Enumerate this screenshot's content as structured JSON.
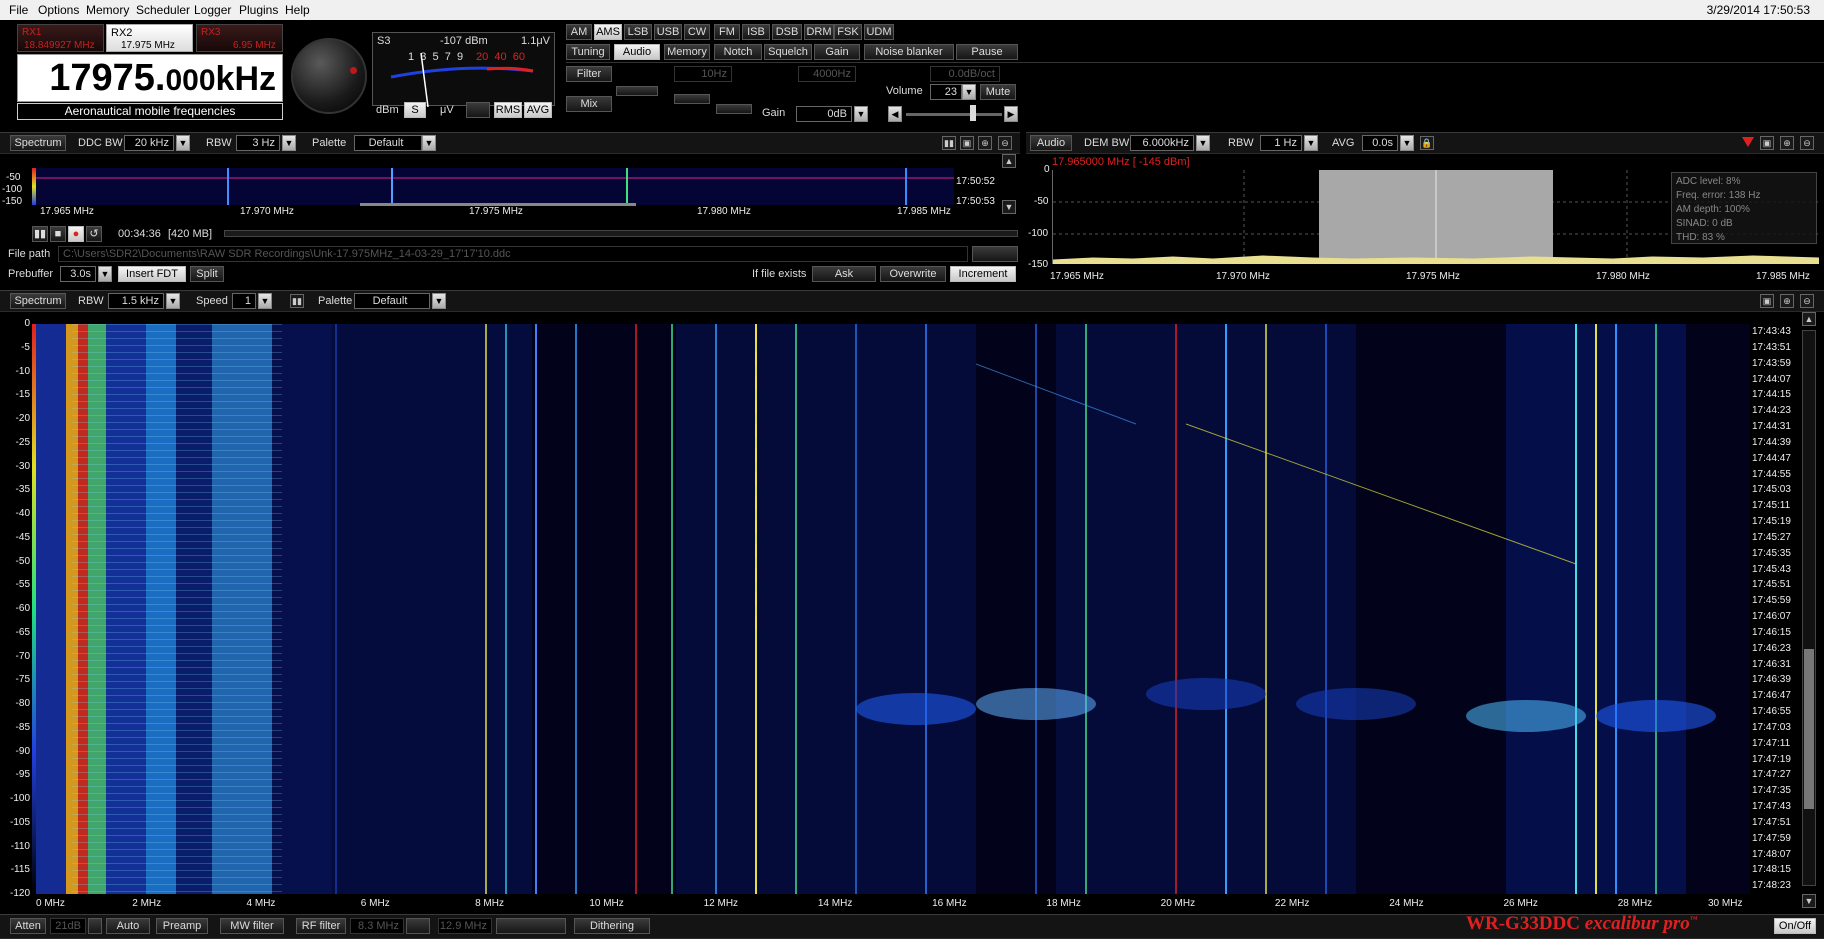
{
  "menu": {
    "items": [
      "File",
      "Options",
      "Memory",
      "Scheduler",
      "Logger",
      "Plugins",
      "Help"
    ],
    "datetime": "3/29/2014 17:50:53"
  },
  "receivers": [
    {
      "label": "RX1",
      "freq": "18.849927 MHz",
      "active": false
    },
    {
      "label": "RX2",
      "freq": "17.975 MHz",
      "active": true
    },
    {
      "label": "RX3",
      "freq": "6.95 MHz",
      "active": false
    }
  ],
  "frequency": {
    "main": "17975.",
    "fine": "000",
    "unit": "kHz",
    "description": "Aeronautical mobile frequencies"
  },
  "smeter": {
    "s_label": "S3",
    "dbm": "-107 dBm",
    "uv": "1.1μV",
    "scale_white": [
      "1",
      "3",
      "5",
      "7",
      "9"
    ],
    "scale_red": [
      "20",
      "40",
      "60"
    ],
    "units": [
      "dBm",
      "S",
      "μV"
    ],
    "selected_unit": "S",
    "modes": [
      "RMS",
      "AVG"
    ]
  },
  "modes": {
    "items": [
      "AM",
      "AMS",
      "LSB",
      "USB",
      "CW",
      "FM",
      "ISB",
      "DSB",
      "DRM",
      "FSK",
      "UDM"
    ],
    "selected": "AMS"
  },
  "tabs": {
    "items": [
      "Tuning",
      "Audio",
      "Memory",
      "Notch",
      "Squelch",
      "Gain",
      "Noise blanker",
      "Pause"
    ],
    "selected": "Audio"
  },
  "audio": {
    "filter_label": "Filter",
    "mix_label": "Mix",
    "filter_low": "10Hz",
    "filter_high": "4000Hz",
    "filter_slope": "0.0dB/oct",
    "volume_label": "Volume",
    "volume": "23",
    "mute_label": "Mute",
    "gain_label": "Gain",
    "gain": "0dB"
  },
  "ddc_spectrum": {
    "tab": "Spectrum",
    "ddc_bw_label": "DDC BW",
    "ddc_bw": "20 kHz",
    "rbw_label": "RBW",
    "rbw": "3 Hz",
    "palette_label": "Palette",
    "palette": "Default",
    "y_ticks": [
      "-50",
      "-100",
      "-150"
    ],
    "times": [
      "17:50:52",
      "17:50:53"
    ],
    "x_ticks": [
      "17.965 MHz",
      "17.970 MHz",
      "17.975 MHz",
      "17.980 MHz",
      "17.985 MHz"
    ]
  },
  "recording": {
    "elapsed": "00:34:36",
    "size": "[420 MB]",
    "file_path_label": "File path",
    "file_path": "C:\\Users\\SDR2\\Documents\\RAW SDR Recordings\\Unk-17.975MHz_14-03-29_17'17'10.ddc",
    "prebuffer_label": "Prebuffer",
    "prebuffer": "3.0s",
    "insert_fdt": "Insert FDT",
    "split": "Split",
    "if_exists_label": "If file exists",
    "options": [
      "Ask",
      "Overwrite",
      "Increment"
    ],
    "selected_option": "Increment"
  },
  "audio_spectrum": {
    "tab": "Audio",
    "dem_bw_label": "DEM BW",
    "dem_bw": "6.000kHz",
    "rbw_label": "RBW",
    "rbw": "1 Hz",
    "avg_label": "AVG",
    "avg": "0.0s",
    "marker": "17.965000 MHz [ -145 dBm]",
    "y_ticks": [
      "0",
      "-50",
      "-100",
      "-150"
    ],
    "x_ticks": [
      "17.965 MHz",
      "17.970 MHz",
      "17.975 MHz",
      "17.980 MHz",
      "17.985 MHz"
    ],
    "info": [
      "ADC level: 8%",
      "Freq. error: 138 Hz",
      "AM depth: 100%",
      "SINAD: 0 dB",
      "THD: 83 %"
    ]
  },
  "wideband": {
    "tab": "Spectrum",
    "rbw_label": "RBW",
    "rbw": "1.5 kHz",
    "speed_label": "Speed",
    "speed": "1",
    "palette_label": "Palette",
    "palette": "Default",
    "y_ticks": [
      "0",
      "-5",
      "-10",
      "-15",
      "-20",
      "-25",
      "-30",
      "-35",
      "-40",
      "-45",
      "-50",
      "-55",
      "-60",
      "-65",
      "-70",
      "-75",
      "-80",
      "-85",
      "-90",
      "-95",
      "-100",
      "-105",
      "-110",
      "-115",
      "-120"
    ],
    "x_ticks": [
      "0 MHz",
      "2 MHz",
      "4 MHz",
      "6 MHz",
      "8 MHz",
      "10 MHz",
      "12 MHz",
      "14 MHz",
      "16 MHz",
      "18 MHz",
      "20 MHz",
      "22 MHz",
      "24 MHz",
      "26 MHz",
      "28 MHz",
      "30 MHz"
    ],
    "times": [
      "17:43:43",
      "17:43:51",
      "17:43:59",
      "17:44:07",
      "17:44:15",
      "17:44:23",
      "17:44:31",
      "17:44:39",
      "17:44:47",
      "17:44:55",
      "17:45:03",
      "17:45:11",
      "17:45:19",
      "17:45:27",
      "17:45:35",
      "17:45:43",
      "17:45:51",
      "17:45:59",
      "17:46:07",
      "17:46:15",
      "17:46:23",
      "17:46:31",
      "17:46:39",
      "17:46:47",
      "17:46:55",
      "17:47:03",
      "17:47:11",
      "17:47:19",
      "17:47:27",
      "17:47:35",
      "17:47:43",
      "17:47:51",
      "17:47:59",
      "17:48:07",
      "17:48:15",
      "17:48:23"
    ]
  },
  "bottombar": {
    "atten_label": "Atten",
    "atten": "21dB",
    "auto": "Auto",
    "preamp": "Preamp",
    "mw_filter": "MW filter",
    "rf_filter_label": "RF filter",
    "rf_low": "8.3 MHz",
    "rf_high": "12.9 MHz",
    "dithering": "Dithering",
    "brand": "WR-G33DDC",
    "brand_sub": "excalibur pro",
    "onoff": "On/Off"
  },
  "colors": {
    "accent_red": "#e02020",
    "waterfall_bg": "#02021a",
    "signal_blue": "#1c3cc8"
  }
}
